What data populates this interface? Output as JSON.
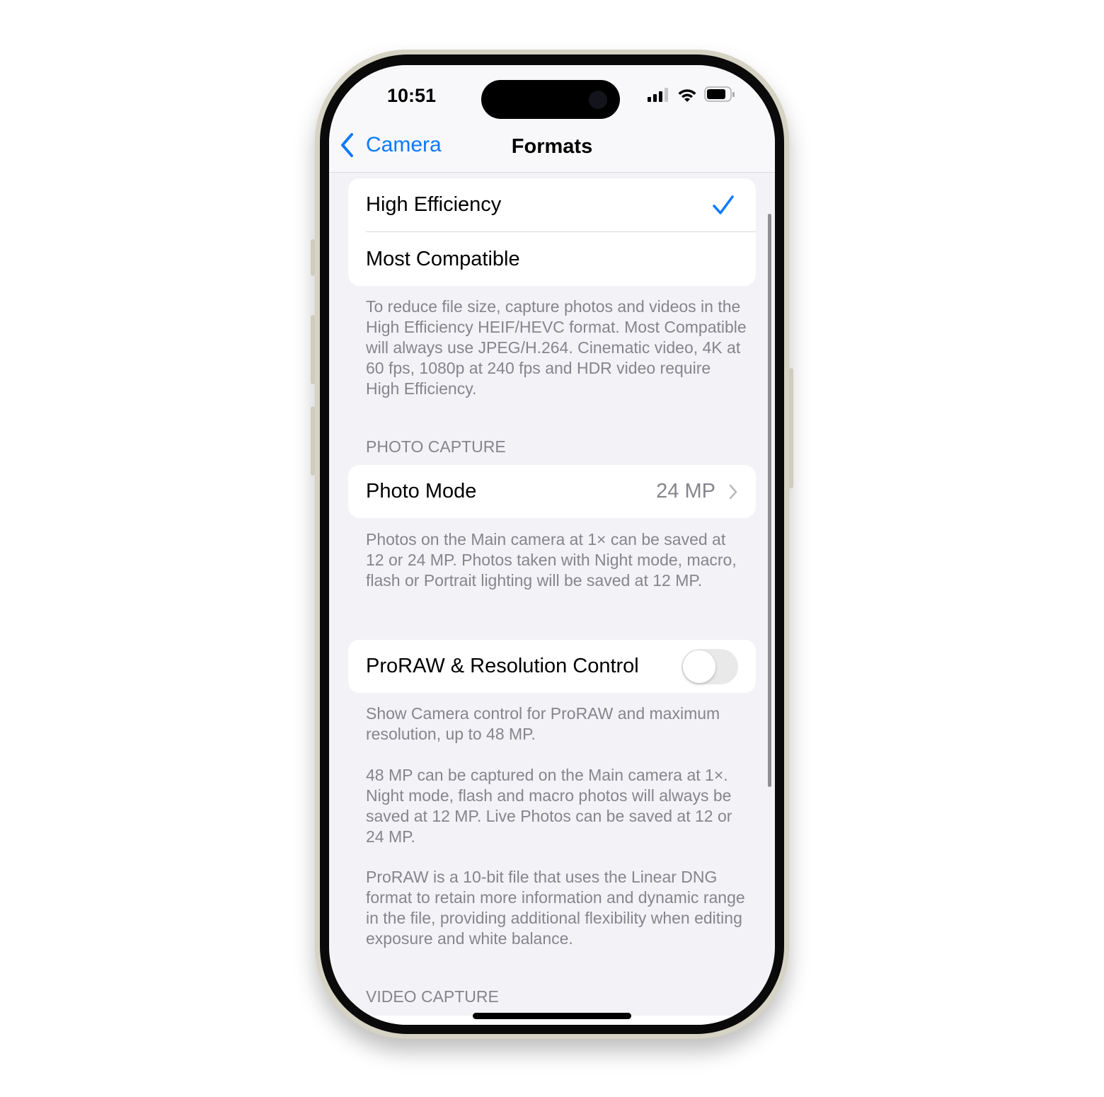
{
  "status_bar": {
    "time": "10:51"
  },
  "nav": {
    "back_label": "Camera",
    "title": "Formats"
  },
  "formats": {
    "options": [
      {
        "label": "High Efficiency",
        "selected": true
      },
      {
        "label": "Most Compatible",
        "selected": false
      }
    ],
    "footer": "To reduce file size, capture photos and videos in the High Efficiency HEIF/HEVC format. Most Compatible will always use JPEG/H.264. Cinematic video, 4K at 60 fps, 1080p at 240 fps and HDR video require High Efficiency."
  },
  "photo_capture": {
    "header": "PHOTO CAPTURE",
    "photo_mode_label": "Photo Mode",
    "photo_mode_value": "24 MP",
    "footer": "Photos on the Main camera at 1× can be saved at 12 or 24 MP. Photos taken with Night mode, macro, flash or Portrait lighting will be saved at 12 MP."
  },
  "proraw": {
    "label": "ProRAW & Resolution Control",
    "enabled": false,
    "footer1": "Show Camera control for ProRAW and maximum resolution, up to 48 MP.",
    "footer2": "48 MP can be captured on the Main camera at 1×. Night mode, flash and macro photos will always be saved at 12 MP. Live Photos can be saved at 12 or 24 MP.",
    "footer3": "ProRAW is a 10-bit file that uses the Linear DNG format to retain more information and dynamic range in the file, providing additional flexibility when editing exposure and white balance."
  },
  "video_capture": {
    "header": "VIDEO CAPTURE"
  },
  "colors": {
    "accent": "#0a7aff",
    "background": "#f2f2f7",
    "secondary_text": "#85858b"
  }
}
